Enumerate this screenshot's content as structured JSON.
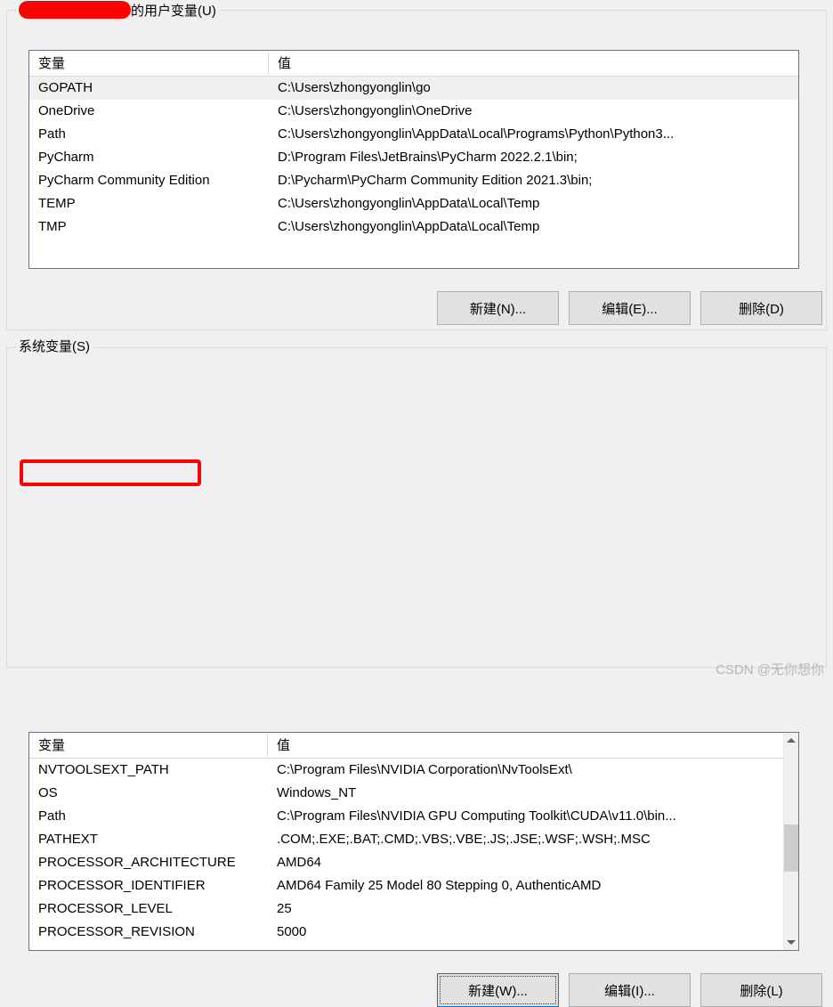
{
  "user_variables": {
    "legend_prefix_redacted": true,
    "legend_suffix": "的用户变量(U)",
    "columns": [
      "变量",
      "值"
    ],
    "rows": [
      {
        "name": "GOPATH",
        "value": "C:\\Users\\zhongyonglin\\go",
        "selected": true
      },
      {
        "name": "OneDrive",
        "value": "C:\\Users\\zhongyonglin\\OneDrive",
        "selected": false
      },
      {
        "name": "Path",
        "value": "C:\\Users\\zhongyonglin\\AppData\\Local\\Programs\\Python\\Python3...",
        "selected": false
      },
      {
        "name": "PyCharm",
        "value": "D:\\Program Files\\JetBrains\\PyCharm 2022.2.1\\bin;",
        "selected": false
      },
      {
        "name": "PyCharm Community Edition",
        "value": "D:\\Pycharm\\PyCharm Community Edition 2021.3\\bin;",
        "selected": false
      },
      {
        "name": "TEMP",
        "value": "C:\\Users\\zhongyonglin\\AppData\\Local\\Temp",
        "selected": false
      },
      {
        "name": "TMP",
        "value": "C:\\Users\\zhongyonglin\\AppData\\Local\\Temp",
        "selected": false
      }
    ],
    "buttons": {
      "new": "新建(N)...",
      "edit": "编辑(E)...",
      "delete": "删除(D)"
    }
  },
  "system_variables": {
    "legend": "系统变量(S)",
    "columns": [
      "变量",
      "值"
    ],
    "rows": [
      {
        "name": "NVTOOLSEXT_PATH",
        "value": "C:\\Program Files\\NVIDIA Corporation\\NvToolsExt\\",
        "annotated": false
      },
      {
        "name": "OS",
        "value": "Windows_NT",
        "annotated": false
      },
      {
        "name": "Path",
        "value": "C:\\Program Files\\NVIDIA GPU Computing Toolkit\\CUDA\\v11.0\\bin...",
        "annotated": true
      },
      {
        "name": "PATHEXT",
        "value": ".COM;.EXE;.BAT;.CMD;.VBS;.VBE;.JS;.JSE;.WSF;.WSH;.MSC",
        "annotated": false
      },
      {
        "name": "PROCESSOR_ARCHITECTURE",
        "value": "AMD64",
        "annotated": false
      },
      {
        "name": "PROCESSOR_IDENTIFIER",
        "value": "AMD64 Family 25 Model 80 Stepping 0, AuthenticAMD",
        "annotated": false
      },
      {
        "name": "PROCESSOR_LEVEL",
        "value": "25",
        "annotated": false
      },
      {
        "name": "PROCESSOR_REVISION",
        "value": "5000",
        "annotated": false
      }
    ],
    "buttons": {
      "new": "新建(W)...",
      "edit": "编辑(I)...",
      "delete": "删除(L)"
    },
    "scrollbar": {
      "up_icon": "chevron-up-icon",
      "down_icon": "chevron-down-icon",
      "thumb_position_percent": 45
    }
  },
  "annotations": {
    "redaction_color": "#fe0000",
    "highlight_color": "#ff0000"
  },
  "watermark": "CSDN @无你想你"
}
